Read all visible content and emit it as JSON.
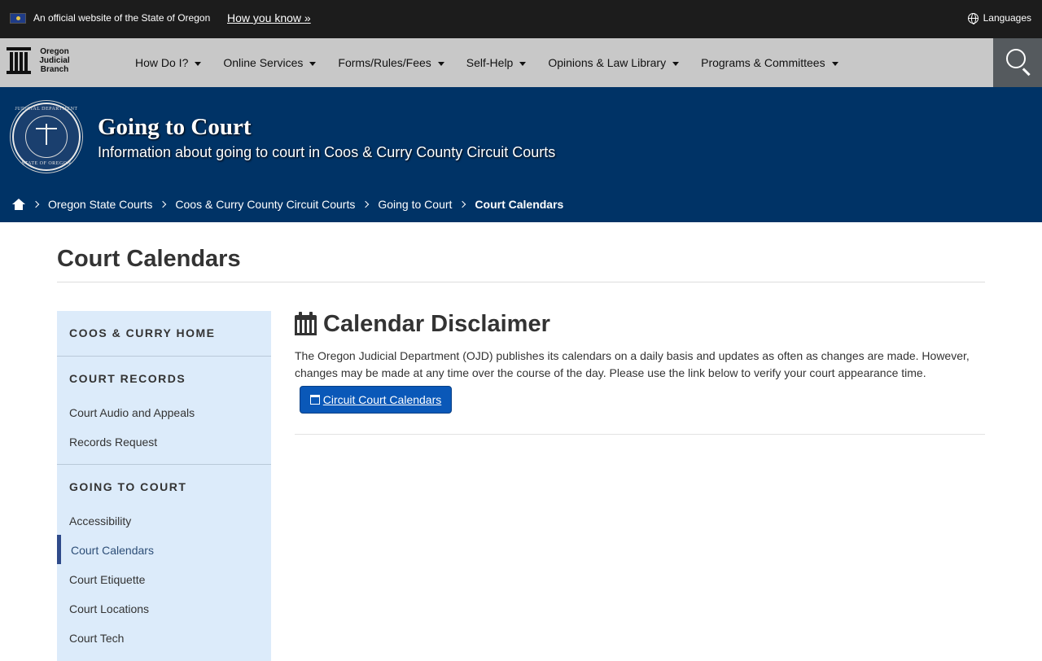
{
  "official_banner": {
    "text": "An official website of the State of Oregon",
    "how_link": "How you know »",
    "languages": "Languages"
  },
  "logo": {
    "line1": "Oregon",
    "line2": "Judicial",
    "line3": "Branch"
  },
  "nav": {
    "items": [
      {
        "label": "How Do I?"
      },
      {
        "label": "Online Services"
      },
      {
        "label": "Forms/Rules/Fees"
      },
      {
        "label": "Self-Help"
      },
      {
        "label": "Opinions & Law Library"
      },
      {
        "label": "Programs & Committees"
      }
    ]
  },
  "header": {
    "title": "Going to Court",
    "subtitle": "Information about going to court in Coos & Curry County Circuit Courts",
    "seal_top": "JUDICIAL DEPARTMENT",
    "seal_bottom": "STATE OF OREGON"
  },
  "breadcrumb": {
    "items": [
      {
        "label": "Oregon State Courts"
      },
      {
        "label": "Coos & Curry County Circuit Courts"
      },
      {
        "label": "Going to Court"
      }
    ],
    "current": "Court Calendars"
  },
  "main": {
    "page_title": "Court Calendars",
    "disclaimer_heading": "Calendar Disclaimer",
    "disclaimer_text": "The Oregon Judicial Department (OJD) publishes its calendars on a daily basis and updates as often as changes are made. However, changes may be made at any time over the course of the day. Please use the link below to verify your court appearance time.",
    "button_label": "Circuit Court Calendars"
  },
  "sidebar": {
    "home": "COOS & CURRY HOME",
    "records_heading": "COURT RECORDS",
    "records_links": [
      "Court Audio and Appeals",
      "Records Request"
    ],
    "going_heading": "GOING TO COURT",
    "going_links": [
      "Accessibility",
      "Court Calendars",
      "Court Etiquette",
      "Court Locations",
      "Court Tech"
    ]
  }
}
